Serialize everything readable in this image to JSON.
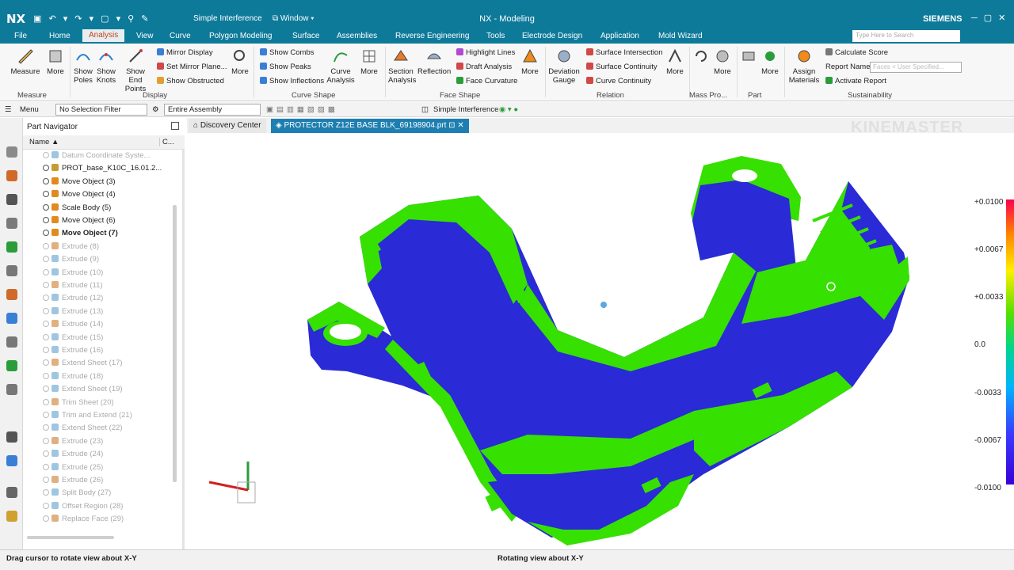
{
  "title_bar": {
    "logo": "NX",
    "command": "Simple Interference",
    "window_menu": "Window",
    "title": "NX - Modeling",
    "brand": "SIEMENS"
  },
  "menu": {
    "items": [
      "File",
      "Home",
      "Analysis",
      "View",
      "Curve",
      "Polygon Modeling",
      "Surface",
      "Assemblies",
      "Reverse Engineering",
      "Tools",
      "Electrode Design",
      "Application",
      "Mold Wizard"
    ],
    "search_placeholder": "Type Here to Search"
  },
  "ribbon": {
    "measure": {
      "big": [
        "Measure",
        "More"
      ],
      "group": "Measure"
    },
    "display": {
      "big": [
        "Show Poles",
        "Show Knots",
        "Show End Points"
      ],
      "small": [
        "Mirror Display",
        "Set Mirror Plane...",
        "Show Obstructed"
      ],
      "more": "More",
      "group": "Display"
    },
    "curve_shape": {
      "small": [
        "Show Combs",
        "Show Peaks",
        "Show Inflections"
      ],
      "big": [
        "Curve Analysis",
        "More"
      ],
      "group": "Curve Shape"
    },
    "face_shape": {
      "big": [
        "Section Analysis",
        "Reflection"
      ],
      "small": [
        "Highlight Lines",
        "Draft Analysis",
        "Face Curvature"
      ],
      "more": "More",
      "group": "Face Shape"
    },
    "relation": {
      "big": [
        "Deviation Gauge"
      ],
      "small": [
        "Surface Intersection",
        "Surface Continuity",
        "Curve Continuity"
      ],
      "more": "More",
      "group": "Relation"
    },
    "mass": {
      "more": "More",
      "group": "Mass Pro..."
    },
    "part": {
      "more": "More",
      "group": "Part"
    },
    "sustainability": {
      "big": [
        "Assign Materials"
      ],
      "small": [
        "Calculate Score",
        "Report Name",
        "Activate Report"
      ],
      "report_value": "Faces < User Specified...",
      "group": "Sustainability"
    }
  },
  "toolbar": {
    "menu": "Menu",
    "selection_filter": "No Selection Filter",
    "scope": "Entire Assembly",
    "command": "Simple Interference"
  },
  "navigator": {
    "title": "Part Navigator",
    "column_name": "Name",
    "column_c": "C...",
    "items": [
      {
        "label": "Datum Coordinate Syste...",
        "state": "dim"
      },
      {
        "label": "PROT_base_K10C_16.01.2...",
        "state": "normal"
      },
      {
        "label": "Move Object (3)",
        "state": "normal"
      },
      {
        "label": "Move Object (4)",
        "state": "normal"
      },
      {
        "label": "Scale Body (5)",
        "state": "normal"
      },
      {
        "label": "Move Object (6)",
        "state": "normal"
      },
      {
        "label": "Move Object (7)",
        "state": "bold"
      },
      {
        "label": "Extrude (8)",
        "state": "dim"
      },
      {
        "label": "Extrude (9)",
        "state": "dim"
      },
      {
        "label": "Extrude (10)",
        "state": "dim"
      },
      {
        "label": "Extrude (11)",
        "state": "dim"
      },
      {
        "label": "Extrude (12)",
        "state": "dim"
      },
      {
        "label": "Extrude (13)",
        "state": "dim"
      },
      {
        "label": "Extrude (14)",
        "state": "dim"
      },
      {
        "label": "Extrude (15)",
        "state": "dim"
      },
      {
        "label": "Extrude (16)",
        "state": "dim"
      },
      {
        "label": "Extend Sheet (17)",
        "state": "dim"
      },
      {
        "label": "Extrude (18)",
        "state": "dim"
      },
      {
        "label": "Extend Sheet (19)",
        "state": "dim"
      },
      {
        "label": "Trim Sheet (20)",
        "state": "dim"
      },
      {
        "label": "Trim and Extend (21)",
        "state": "dim"
      },
      {
        "label": "Extend Sheet (22)",
        "state": "dim"
      },
      {
        "label": "Extrude (23)",
        "state": "dim"
      },
      {
        "label": "Extrude (24)",
        "state": "dim"
      },
      {
        "label": "Extrude (25)",
        "state": "dim"
      },
      {
        "label": "Extrude (26)",
        "state": "dim"
      },
      {
        "label": "Split Body (27)",
        "state": "dim"
      },
      {
        "label": "Offset Region (28)",
        "state": "dim"
      },
      {
        "label": "Replace Face (29)",
        "state": "dim"
      }
    ]
  },
  "tabs": [
    "Discovery Center",
    "PROTECTOR Z12E BASE BLK_69198904.prt"
  ],
  "scale_labels": [
    "+0.0100",
    "+0.0067",
    "+0.0033",
    "0.0",
    "-0.0033",
    "-0.0067",
    "-0.0100"
  ],
  "watermark": "KINEMASTER",
  "status": {
    "left": "Drag cursor to rotate view about X-Y",
    "center": "Rotating view about X-Y"
  },
  "colors": {
    "titlebar": "#0e7a9a",
    "model_green": "#36e000",
    "model_blue": "#2a2ad6",
    "tab_active": "#1d7fb1"
  }
}
